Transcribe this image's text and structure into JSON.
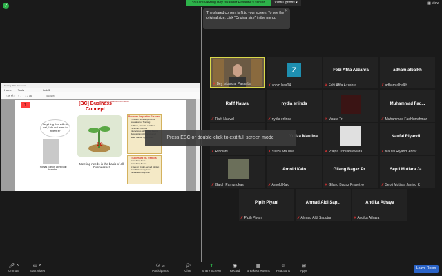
{
  "top": {
    "banner": "You are viewing Bey Iskandar Pasariba's screen",
    "view_options": "View Options ▾",
    "view": "View",
    "tooltip": "The shared content is fit to your screen. To see the original size, click \"Original size\" in the menu."
  },
  "shared_screen": {
    "pdf_title": "Sharing PDF document",
    "menu": [
      "Home",
      "Tools",
      "bab 3"
    ],
    "page_num": "1",
    "page_total": "/ 16",
    "zoom": "56.4%",
    "slide_number": "1",
    "slide_title": "[BC] Business Concept",
    "annotation": "Something Desired in the world?",
    "quote": "\"Anything that will not sell, I do not want to invent it!\"",
    "quote_author": "Thomas Edison Light Bulb Inventor",
    "center_label": "BC",
    "bottom_text": "Meeting needs is the basis of all businesses!",
    "box1_title": "Business Inspiration Sources:",
    "box1_items": [
      "Previous Work Experience",
      "Education or Training",
      "Hobbies, Talents, or Other Personal Interests",
      "Interactions with Other People",
      "Recognition of Unanswered Need Market Opportunity"
    ],
    "box2_title": "Successful BC Reflects:",
    "box2_items": [
      "Something New",
      "Something Better",
      "A New or Under-served Market",
      "New Delivery System",
      "Increased Integration"
    ]
  },
  "notice": "Press ESC or double-click to exit full screen mode",
  "participants": [
    {
      "name": "",
      "label": "Bey Iskandar Pasariba",
      "type": "video"
    },
    {
      "name": "",
      "label": "zoom baa04",
      "type": "avatar",
      "letter": "Z"
    },
    {
      "name": "Febi Afifa Azzahra",
      "label": "Febi Afifa Azzahra",
      "type": "name"
    },
    {
      "name": "adham albalkh",
      "label": "adham albalkh",
      "type": "name"
    },
    {
      "name": "Rafif Nauval",
      "label": "Rafif Nauval",
      "type": "name"
    },
    {
      "name": "nydia erlinda",
      "label": "nydia erlinda",
      "type": "name"
    },
    {
      "name": "",
      "label": "Maura Tri",
      "type": "photo"
    },
    {
      "name": "Muhammad Fad...",
      "label": "Muhammad Fadhlurrahman",
      "type": "name"
    },
    {
      "name": "",
      "label": "Rindiani",
      "type": "name"
    },
    {
      "name": "Yuliza Maulina",
      "label": "Yuliza Maulina",
      "type": "name"
    },
    {
      "name": "",
      "label": "Prajna Tribuanaswara",
      "type": "photo"
    },
    {
      "name": "Naufal Riyandi...",
      "label": "Naufal Riyandi Abrar",
      "type": "name"
    },
    {
      "name": "",
      "label": "Galuh Pamungkas",
      "type": "photo"
    },
    {
      "name": "Arnold Kalo",
      "label": "Arnold Kalo",
      "type": "name"
    },
    {
      "name": "Gilang Bagaz Pr...",
      "label": "Gilang Bagaz Prasetyo",
      "type": "name"
    },
    {
      "name": "Septi Mutiara Ja...",
      "label": "Septi Mutiara Janing K",
      "type": "name"
    },
    {
      "name": "Pipih Piyani",
      "label": "Pipih Piyani",
      "type": "name"
    },
    {
      "name": "Ahmad Aldi Sap...",
      "label": "Ahmad Aldi Saputra",
      "type": "name"
    },
    {
      "name": "Andika Athaya",
      "label": "Andika Athaya",
      "type": "name"
    }
  ],
  "toolbar": {
    "unmute": "Unmute",
    "start_video": "Start Video",
    "participants": "Participants",
    "participants_count": "19",
    "chat": "Chat",
    "share_screen": "Share Screen",
    "record": "Record",
    "breakout": "Breakout Rooms",
    "reactions": "Reactions",
    "apps": "Apps",
    "leave": "Leave Room"
  },
  "colors": {
    "accent_green": "#2db34a",
    "leave_blue": "#2a63c7",
    "title_red": "#cc0000"
  }
}
